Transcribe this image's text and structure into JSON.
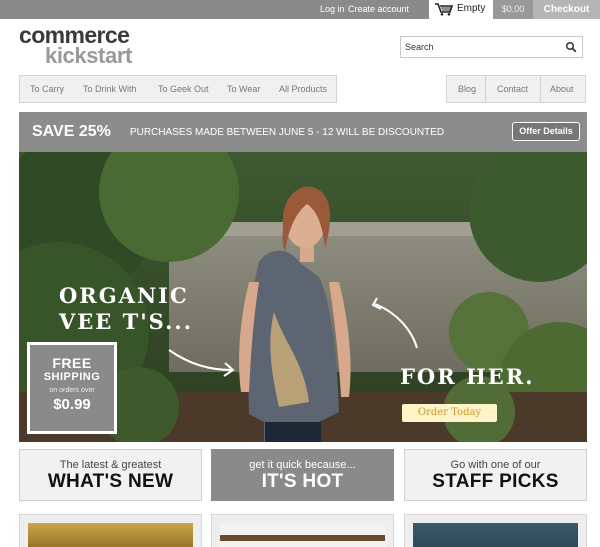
{
  "topbar": {
    "login": "Log in",
    "create_account": "Create account",
    "cart_label": "Empty",
    "cart_total": "$0.00",
    "checkout": "Checkout"
  },
  "logo": {
    "line1": "commerce",
    "line2": "kickstart"
  },
  "search": {
    "placeholder": "Search"
  },
  "nav_main": [
    "To Carry",
    "To Drink With",
    "To Geek Out",
    "To Wear",
    "All Products"
  ],
  "nav_secondary": [
    "Blog",
    "Contact",
    "About"
  ],
  "promo": {
    "headline": "SAVE 25%",
    "text": "PURCHASES MADE BETWEEN JUNE 5 - 12 WILL BE DISCOUNTED",
    "button": "Offer Details"
  },
  "hero": {
    "title": "ORGANIC\nVEE T'S...",
    "subtitle": "FOR HER.",
    "button": "Order Today",
    "shipping": {
      "line1": "FREE",
      "line2": "SHIPPING",
      "line3": "on orders over",
      "amount": "$0.99"
    }
  },
  "tiles": [
    {
      "small": "The latest & greatest",
      "big": "WHAT'S NEW"
    },
    {
      "small": "get it quick because...",
      "big": "IT'S HOT"
    },
    {
      "small": "Go with one of our",
      "big": "STAFF PICKS"
    }
  ],
  "colors": {
    "bar_gray": "#8a8a8a",
    "order_text": "#d4962a",
    "order_bg": "#fff3c8"
  },
  "icons": {
    "cart": "shopping-cart-icon",
    "search": "magnifier-icon"
  }
}
